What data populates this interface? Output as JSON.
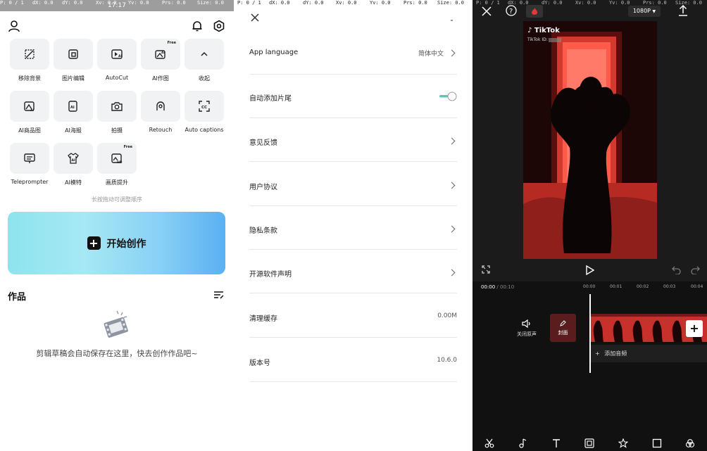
{
  "debug_overlay": {
    "panel1": [
      "P: 0 / 1",
      "dX: 0.0",
      "dY: 0.0",
      "Xv: 0.0",
      "Yv: 0.0",
      "Prs: 0.0",
      "Size: 0.0"
    ],
    "panel2": [
      "P: 0 / 1",
      "dX: 0.0",
      "dY: 0.0",
      "Xv: 0.0",
      "Yv: 0.0",
      "Prs: 0.0",
      "Size: 0.0"
    ],
    "panel3": [
      "P: 0 / 1",
      "dX: 0.0",
      "dY: 0.0",
      "Xv: 0.0",
      "Yv: 0.0",
      "Prs: 0.0",
      "Size: 0.0"
    ]
  },
  "home": {
    "status_time": "17:17",
    "tools": [
      {
        "label": "移除背景",
        "icon": "remove-background-icon",
        "badge": ""
      },
      {
        "label": "图片编辑",
        "icon": "image-edit-icon",
        "badge": ""
      },
      {
        "label": "AutoCut",
        "icon": "autocut-icon",
        "badge": ""
      },
      {
        "label": "AI作图",
        "icon": "ai-image-icon",
        "badge": "Free"
      },
      {
        "label": "收起",
        "icon": "collapse-icon",
        "badge": ""
      },
      {
        "label": "AI商品图",
        "icon": "ai-product-image-icon",
        "badge": ""
      },
      {
        "label": "AI海报",
        "icon": "ai-poster-icon",
        "badge": ""
      },
      {
        "label": "拍摄",
        "icon": "camera-icon",
        "badge": ""
      },
      {
        "label": "Retouch",
        "icon": "retouch-icon",
        "badge": ""
      },
      {
        "label": "Auto captions",
        "icon": "auto-captions-icon",
        "badge": ""
      },
      {
        "label": "Teleprompter",
        "icon": "teleprompter-icon",
        "badge": ""
      },
      {
        "label": "AI模特",
        "icon": "ai-model-icon",
        "badge": ""
      },
      {
        "label": "画质提升",
        "icon": "hd-upscale-icon",
        "badge": "Free"
      }
    ],
    "hint": "长按拖动可调整顺序",
    "create_label": "开始创作",
    "works_title": "作品",
    "empty_text": "剪辑草稿会自动保存在这里，快去创作作品吧~"
  },
  "settings": {
    "rows": [
      {
        "label": "App language",
        "value": "简体中文",
        "type": "chevron"
      },
      {
        "label": "自动添加片尾",
        "value": "",
        "type": "toggle"
      },
      {
        "label": "意见反馈",
        "value": "",
        "type": "chevron"
      },
      {
        "label": "用户协议",
        "value": "",
        "type": "chevron"
      },
      {
        "label": "隐私条款",
        "value": "",
        "type": "chevron"
      },
      {
        "label": "开源软件声明",
        "value": "",
        "type": "chevron"
      },
      {
        "label": "清理缓存",
        "value": "0.00M",
        "type": "value"
      },
      {
        "label": "版本号",
        "value": "10.6.0",
        "type": "value"
      }
    ],
    "accent": "#5fc6b3"
  },
  "editor": {
    "resolution": "1080P",
    "tiktok_brand": "TikTok",
    "tiktok_id_label": "TikTok ID:",
    "current_time": "00:00",
    "total_time": "00:10",
    "ticks": [
      "00:00",
      "00:01",
      "00:02",
      "00:03",
      "00:04"
    ],
    "mute_label": "关闭原声",
    "cover_label": "封面",
    "add_audio_label": "添加音频",
    "colors": {
      "clip": "#c8312b",
      "background": "#111111"
    }
  }
}
